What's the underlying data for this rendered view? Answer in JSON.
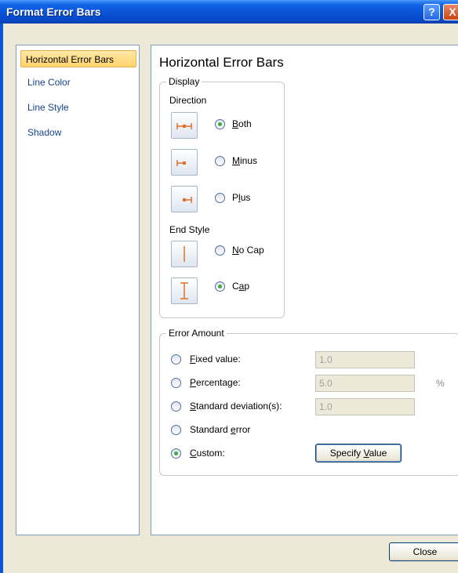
{
  "window": {
    "title": "Format Error Bars",
    "help_glyph": "?",
    "close_glyph": "X"
  },
  "nav": {
    "items": [
      {
        "label": "Horizontal Error Bars",
        "active": true
      },
      {
        "label": "Line Color"
      },
      {
        "label": "Line Style"
      },
      {
        "label": "Shadow"
      }
    ]
  },
  "main": {
    "heading": "Horizontal Error Bars",
    "display": {
      "group_label": "Display",
      "direction_label": "Direction",
      "direction_options": [
        {
          "key": "B",
          "rest": "oth",
          "icon": "both-direction-icon",
          "selected": true
        },
        {
          "key": "M",
          "rest": "inus",
          "icon": "minus-direction-icon",
          "selected": false
        },
        {
          "pre": "P",
          "key": "l",
          "rest": "us",
          "icon": "plus-direction-icon",
          "selected": false
        }
      ],
      "end_style_label": "End Style",
      "end_style_options": [
        {
          "key": "N",
          "rest": "o Cap",
          "icon": "no-cap-icon",
          "selected": false
        },
        {
          "pre": "C",
          "key": "a",
          "rest": "p",
          "icon": "cap-icon",
          "selected": true
        }
      ]
    },
    "error_amount": {
      "group_label": "Error Amount",
      "options": [
        {
          "key": "F",
          "rest": "ixed value:",
          "value": "1.0",
          "selected": false
        },
        {
          "key": "P",
          "rest": "ercentage:",
          "value": "5.0",
          "suffix": "%",
          "selected": false
        },
        {
          "key": "S",
          "rest": "tandard deviation(s):",
          "value": "1.0",
          "selected": false
        },
        {
          "pre": "Standard ",
          "key": "e",
          "rest": "rror",
          "selected": false
        },
        {
          "key": "C",
          "rest": "ustom:",
          "selected": true
        }
      ],
      "specify_button": {
        "pre": "Specify ",
        "key": "V",
        "rest": "alue"
      }
    }
  },
  "footer": {
    "close_label": "Close"
  },
  "colors": {
    "accent_orange": "#e0702a",
    "titlebar_blue": "#0a55d8",
    "radio_green": "#3fa93f"
  }
}
